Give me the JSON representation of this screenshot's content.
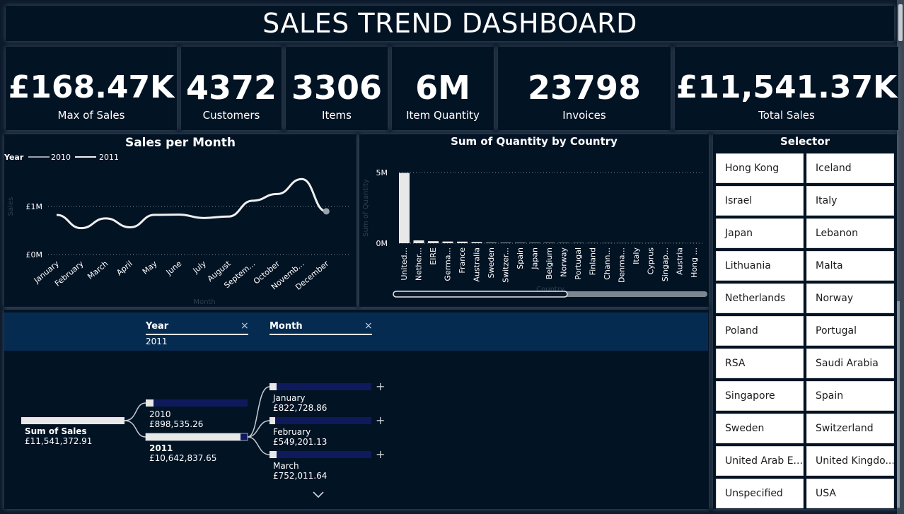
{
  "title": "SALES TREND DASHBOARD",
  "kpis": [
    {
      "value": "£168.47K",
      "label": "Max of Sales"
    },
    {
      "value": "4372",
      "label": "Customers"
    },
    {
      "value": "3306",
      "label": "Items"
    },
    {
      "value": "6M",
      "label": "Item Quantity"
    },
    {
      "value": "23798",
      "label": "Invoices"
    },
    {
      "value": "£11,541.37K",
      "label": "Total Sales"
    }
  ],
  "colors": {
    "background": "#0c1b2c",
    "panel": "#021324",
    "accent": "#0f1a5c",
    "breadcrumb": "#062b51"
  },
  "chart_data": [
    {
      "type": "line",
      "title": "Sales per Month",
      "legend_title": "Year",
      "legend_placement": "top-left",
      "xlabel": "Month",
      "ylabel": "Sales",
      "categories": [
        "January",
        "February",
        "March",
        "April",
        "May",
        "June",
        "July",
        "August",
        "Septem...",
        "October",
        "Novemb...",
        "December"
      ],
      "yticks": [
        "£0M",
        "£1M"
      ],
      "ylim": [
        0,
        2000000
      ],
      "series": [
        {
          "name": "2010",
          "values": [
            null,
            null,
            null,
            null,
            null,
            null,
            null,
            null,
            null,
            null,
            null,
            898535.26
          ]
        },
        {
          "name": "2011",
          "values": [
            822728.86,
            549201.13,
            752011.64,
            566000,
            825000,
            830000,
            760000,
            790000,
            1120000,
            1260000,
            1570000,
            898535
          ]
        }
      ]
    },
    {
      "type": "bar",
      "title": "Sum of Quantity by Country",
      "xlabel": "Country",
      "ylabel": "Sum of Quantity",
      "categories": [
        "United...",
        "Nether...",
        "EIRE",
        "Germa...",
        "France",
        "Australia",
        "Sweden",
        "Switzer...",
        "Spain",
        "Japan",
        "Belgium",
        "Norway",
        "Portugal",
        "Finland",
        "Chann...",
        "Denma...",
        "Italy",
        "Cyprus",
        "Singap...",
        "Austria",
        "Hong ..."
      ],
      "yticks": [
        "0M",
        "5M"
      ],
      "ylim": [
        0,
        5000000
      ],
      "values": [
        4970000,
        200000,
        143000,
        120000,
        112000,
        84000,
        36000,
        30000,
        27000,
        26000,
        23000,
        19000,
        16000,
        11000,
        10000,
        8000,
        8000,
        7000,
        5000,
        5000,
        4800
      ]
    }
  ],
  "selector": {
    "title": "Selector",
    "items": [
      "Hong Kong",
      "Iceland",
      "Israel",
      "Italy",
      "Japan",
      "Lebanon",
      "Lithuania",
      "Malta",
      "Netherlands",
      "Norway",
      "Poland",
      "Portugal",
      "RSA",
      "Saudi Arabia",
      "Singapore",
      "Spain",
      "Sweden",
      "Switzerland",
      "United Arab E...",
      "United Kingdo...",
      "Unspecified",
      "USA"
    ]
  },
  "decomp": {
    "crumbs": [
      {
        "label": "Year",
        "value": "2011"
      },
      {
        "label": "Month",
        "value": ""
      }
    ],
    "close_icon": "×",
    "root": {
      "label": "Sum of Sales",
      "value": "£11,541,372.91"
    },
    "years": [
      {
        "label": "2010",
        "value": "£898,535.26",
        "fill": 0.084
      },
      {
        "label": "2011",
        "value": "£10,642,837.65",
        "fill": 0.93
      }
    ],
    "months": [
      {
        "label": "January",
        "value": "£822,728.86",
        "fill": 0.06
      },
      {
        "label": "February",
        "value": "£549,201.13",
        "fill": 0.05
      },
      {
        "label": "March",
        "value": "£752,011.64",
        "fill": 0.06
      }
    ],
    "plus_icon": "+",
    "expand_icon": "chevron-down"
  }
}
